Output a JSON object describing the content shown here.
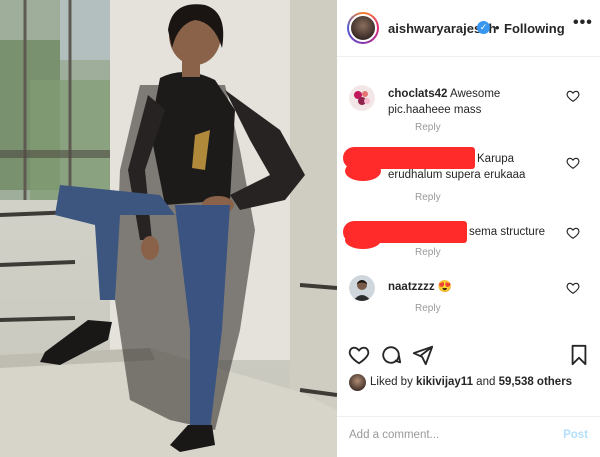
{
  "header": {
    "username": "aishwaryarajessh",
    "verified_glyph": "✓",
    "separator": "•",
    "follow_state": "Following",
    "more_glyph": "•••"
  },
  "comments": [
    {
      "username": "choclats42",
      "text": "Awesome pic.haaheee mass",
      "reply": "Reply",
      "avatar_icon": "flower-avatar"
    },
    {
      "username": "",
      "text": "Karupa erudhalum supera erukaaa",
      "reply": "Reply",
      "redacted": true
    },
    {
      "username": "",
      "text": "sema structure",
      "reply": "Reply",
      "redacted": true
    },
    {
      "username": "naatzzzz",
      "emoji": "😍",
      "reply": "Reply",
      "avatar_icon": "person-avatar"
    }
  ],
  "actions": {
    "icons": [
      "heart-icon",
      "comment-icon",
      "share-icon",
      "bookmark-icon"
    ]
  },
  "likes": {
    "prefix": "Liked by",
    "user": "kikivijay11",
    "conjunction": "and",
    "count": "59,538 others"
  },
  "add_comment": {
    "placeholder": "Add a comment...",
    "post_label": "Post"
  },
  "colors": {
    "verified": "#3897f0",
    "redaction": "#ff2a2a",
    "post_disabled": "#b2dffc"
  }
}
